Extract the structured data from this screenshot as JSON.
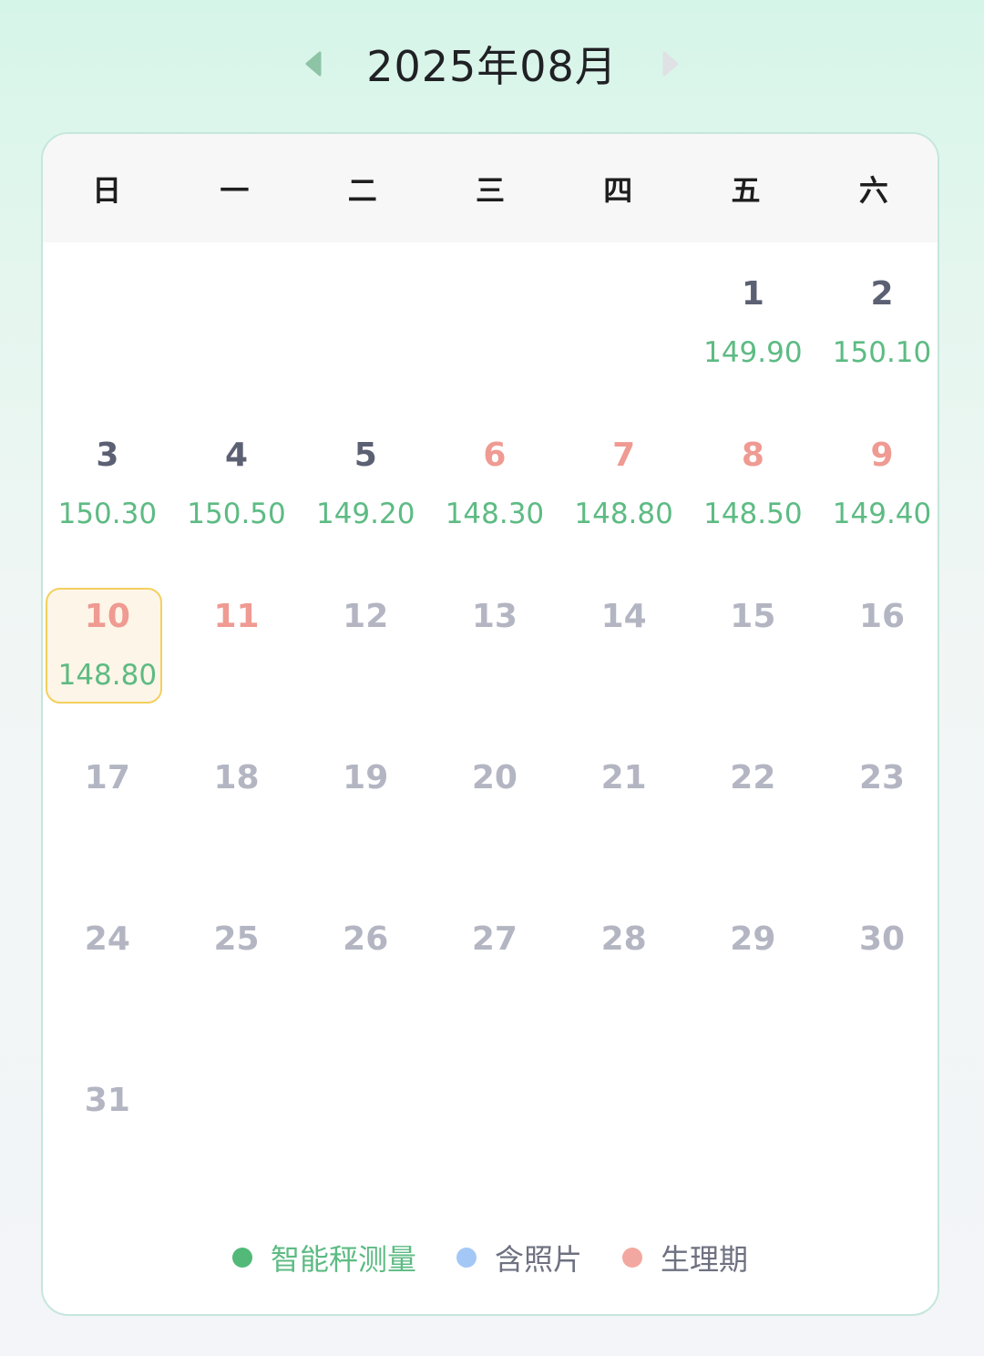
{
  "header": {
    "title": "2025年08月",
    "prev_color": "#8dc4a6",
    "next_color": "#dfe1e4"
  },
  "weekdays": [
    "日",
    "一",
    "二",
    "三",
    "四",
    "五",
    "六"
  ],
  "days": [
    {
      "day": "1",
      "value": "149.90",
      "state": "has"
    },
    {
      "day": "2",
      "value": "150.10",
      "state": "has"
    },
    {
      "day": "3",
      "value": "150.30",
      "state": "has"
    },
    {
      "day": "4",
      "value": "150.50",
      "state": "has"
    },
    {
      "day": "5",
      "value": "149.20",
      "state": "has"
    },
    {
      "day": "6",
      "value": "148.30",
      "state": "period"
    },
    {
      "day": "7",
      "value": "148.80",
      "state": "period"
    },
    {
      "day": "8",
      "value": "148.50",
      "state": "period"
    },
    {
      "day": "9",
      "value": "149.40",
      "state": "period"
    },
    {
      "day": "10",
      "value": "148.80",
      "state": "period",
      "selected": true
    },
    {
      "day": "11",
      "value": "",
      "state": "period"
    },
    {
      "day": "12",
      "value": "",
      "state": "future"
    },
    {
      "day": "13",
      "value": "",
      "state": "future"
    },
    {
      "day": "14",
      "value": "",
      "state": "future"
    },
    {
      "day": "15",
      "value": "",
      "state": "future"
    },
    {
      "day": "16",
      "value": "",
      "state": "future"
    },
    {
      "day": "17",
      "value": "",
      "state": "future"
    },
    {
      "day": "18",
      "value": "",
      "state": "future"
    },
    {
      "day": "19",
      "value": "",
      "state": "future"
    },
    {
      "day": "20",
      "value": "",
      "state": "future"
    },
    {
      "day": "21",
      "value": "",
      "state": "future"
    },
    {
      "day": "22",
      "value": "",
      "state": "future"
    },
    {
      "day": "23",
      "value": "",
      "state": "future"
    },
    {
      "day": "24",
      "value": "",
      "state": "future"
    },
    {
      "day": "25",
      "value": "",
      "state": "future"
    },
    {
      "day": "26",
      "value": "",
      "state": "future"
    },
    {
      "day": "27",
      "value": "",
      "state": "future"
    },
    {
      "day": "28",
      "value": "",
      "state": "future"
    },
    {
      "day": "29",
      "value": "",
      "state": "future"
    },
    {
      "day": "30",
      "value": "",
      "state": "future"
    },
    {
      "day": "31",
      "value": "",
      "state": "future"
    }
  ],
  "legend": [
    {
      "label": "智能秤测量",
      "color": "#52b978",
      "text_color": "#5dbb83"
    },
    {
      "label": "含照片",
      "color": "#a4c8f5",
      "text_color": "#6e7180"
    },
    {
      "label": "生理期",
      "color": "#f2a8a0",
      "text_color": "#6e7180"
    }
  ]
}
